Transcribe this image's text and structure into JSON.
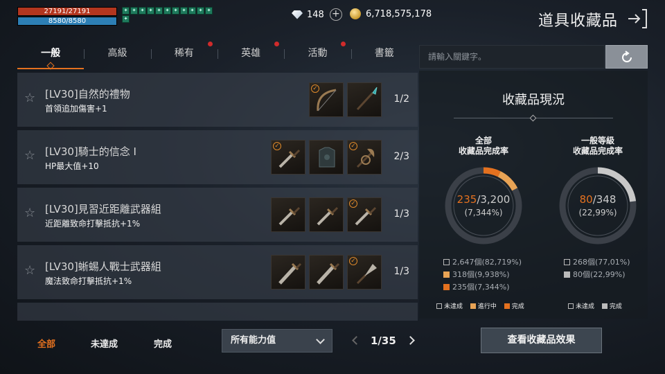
{
  "hud": {
    "hp_text": "27191/27191",
    "hp_fraction": 1.0,
    "mp_text": "8580/8580",
    "mp_fraction": 1.0,
    "buff_glyphs": [
      "✦",
      "✦",
      "✦",
      "✦",
      "✦",
      "✦",
      "✦",
      "✦",
      "✦",
      "✦",
      "✦",
      "✦"
    ],
    "diamonds": "148",
    "gold": "6,718,575,178",
    "title": "道具收藏品"
  },
  "tabs": [
    {
      "label": "一般",
      "active": true,
      "notify": false
    },
    {
      "label": "高級",
      "active": false,
      "notify": false
    },
    {
      "label": "稀有",
      "active": false,
      "notify": true
    },
    {
      "label": "英雄",
      "active": false,
      "notify": true
    },
    {
      "label": "活動",
      "active": false,
      "notify": true
    },
    {
      "label": "書籤",
      "active": false,
      "notify": false
    }
  ],
  "collections": [
    {
      "name": "[LV30]自然的禮物",
      "effect": "首領追加傷害+1",
      "progress": "1/2",
      "slots": [
        {
          "item": "bow",
          "collected": true
        },
        {
          "item": "spear",
          "collected": false
        }
      ]
    },
    {
      "name": "[LV30]騎士的信念 I",
      "effect": "HP最大值+10",
      "progress": "2/3",
      "slots": [
        {
          "item": "dagger",
          "collected": true
        },
        {
          "item": "armor",
          "collected": false
        },
        {
          "item": "axe",
          "collected": true
        }
      ]
    },
    {
      "name": "[LV30]見習近距離武器組",
      "effect": "近距離致命打擊抵抗+1%",
      "progress": "1/3",
      "slots": [
        {
          "item": "dagger",
          "collected": false
        },
        {
          "item": "dagger",
          "collected": false
        },
        {
          "item": "dagger",
          "collected": true
        }
      ]
    },
    {
      "name": "[LV30]蜥蜴人戰士武器組",
      "effect": "魔法致命打擊抵抗+1%",
      "progress": "1/3",
      "slots": [
        {
          "item": "sword",
          "collected": false
        },
        {
          "item": "sword",
          "collected": false
        },
        {
          "item": "spade",
          "collected": true
        }
      ]
    }
  ],
  "filters": {
    "all": "全部",
    "incomplete": "未達成",
    "complete": "完成"
  },
  "stat_filter": "所有能力值",
  "pager": "1/35",
  "search": {
    "placeholder": "請輸入關鍵字。"
  },
  "panel": {
    "title": "收藏品現況",
    "all": {
      "head1": "全部",
      "head2": "收藏品完成率",
      "done": "235",
      "total": "/3,200",
      "pct": "(7,344%)",
      "fraction": 0.0734,
      "progress_fraction": 0.0994,
      "rows": [
        {
          "text": "2,647個(82,719%)",
          "kind": "empty"
        },
        {
          "text": "318個(9,938%)",
          "kind": "prog"
        },
        {
          "text": "235個(7,344%)",
          "kind": "done"
        }
      ],
      "legend": {
        "empty": "未達成",
        "prog": "進行中",
        "done": "完成"
      }
    },
    "normal": {
      "head1": "一般等級",
      "head2": "收藏品完成率",
      "done": "80",
      "total": "/348",
      "pct": "(22,99%)",
      "fraction": 0.2299,
      "rows": [
        {
          "text": "268個(77,01%)",
          "kind": "empty"
        },
        {
          "text": "80個(22,99%)",
          "kind": "gray"
        }
      ],
      "legend": {
        "empty": "未達成",
        "done": "完成"
      }
    }
  },
  "view_button": "查看收藏品效果",
  "colors": {
    "accent": "#e4711f",
    "progress": "#e8a355",
    "hp": "#b3361f",
    "mp": "#2d7fb5"
  }
}
